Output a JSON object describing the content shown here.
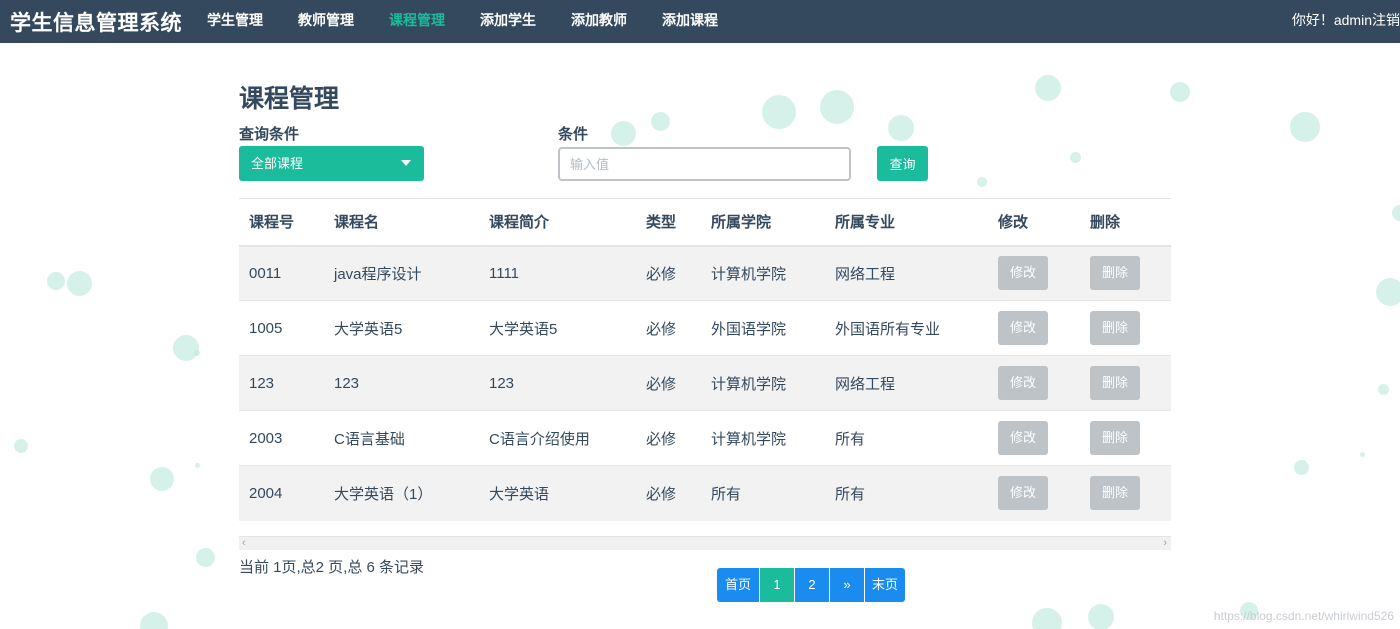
{
  "navbar": {
    "brand": "学生信息管理系统",
    "items": [
      {
        "label": "学生管理",
        "active": false
      },
      {
        "label": "教师管理",
        "active": false
      },
      {
        "label": "课程管理",
        "active": true
      },
      {
        "label": "添加学生",
        "active": false
      },
      {
        "label": "添加教师",
        "active": false
      },
      {
        "label": "添加课程",
        "active": false
      }
    ],
    "greeting": "你好！admin",
    "logout": "注销"
  },
  "page": {
    "title": "课程管理",
    "query_label": "查询条件",
    "condition_label": "条件",
    "select_value": "全部课程",
    "input_placeholder": "输入值",
    "input_value": "",
    "query_button": "查询"
  },
  "table": {
    "headers": [
      "课程号",
      "课程名",
      "课程简介",
      "类型",
      "所属学院",
      "所属专业",
      "修改",
      "删除"
    ],
    "rows": [
      [
        "0011",
        "java程序设计",
        "1111",
        "必修",
        "计算机学院",
        "网络工程"
      ],
      [
        "1005",
        "大学英语5",
        "大学英语5",
        "必修",
        "外国语学院",
        "外国语所有专业"
      ],
      [
        "123",
        "123",
        "123",
        "必修",
        "计算机学院",
        "网络工程"
      ],
      [
        "2003",
        "C语言基础",
        "C语言介绍使用",
        "必修",
        "计算机学院",
        "所有"
      ],
      [
        "2004",
        "大学英语（1）",
        "大学英语",
        "必修",
        "所有",
        "所有"
      ]
    ],
    "edit_label": "修改",
    "delete_label": "删除"
  },
  "record_info": "当前 1页,总2 页,总 6 条记录",
  "pagination": {
    "first": "首页",
    "pages": [
      "1",
      "2"
    ],
    "current_page": "1",
    "next": "»",
    "last": "末页"
  },
  "watermark": "https://blog.csdn.net/whirlwind526",
  "colors": {
    "navbar_bg": "#34495e",
    "accent": "#1abc9c",
    "pagination_blue": "#1a8cf0",
    "disabled_button": "#bdc3c7"
  }
}
